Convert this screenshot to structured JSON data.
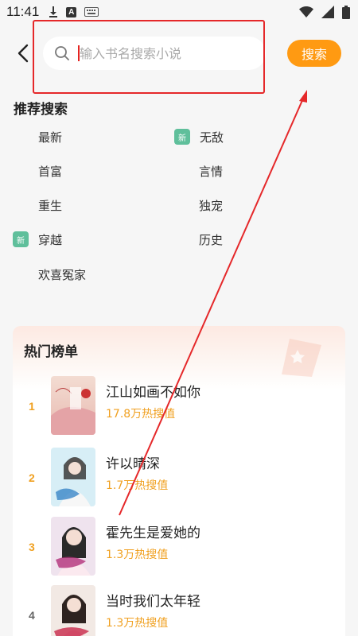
{
  "status": {
    "time": "11:41",
    "icons_left": [
      "download-icon",
      "a-keyboard-icon",
      "keyboard-icon"
    ],
    "icons_right": [
      "wifi-icon",
      "signal-icon",
      "battery-icon"
    ]
  },
  "search": {
    "placeholder": "输入书名搜索小说",
    "button_label": "搜索"
  },
  "recommended": {
    "title": "推荐搜索",
    "new_badge": "新",
    "items": [
      {
        "label": "最新",
        "new": false
      },
      {
        "label": "无敌",
        "new": true
      },
      {
        "label": "首富",
        "new": false
      },
      {
        "label": "言情",
        "new": false
      },
      {
        "label": "重生",
        "new": false
      },
      {
        "label": "独宠",
        "new": false
      },
      {
        "label": "穿越",
        "new": true
      },
      {
        "label": "历史",
        "new": false
      },
      {
        "label": "欢喜冤家",
        "new": false
      }
    ]
  },
  "hot": {
    "title": "热门榜单",
    "books": [
      {
        "rank": "1",
        "title": "江山如画不如你",
        "heat": "17.8万热搜值"
      },
      {
        "rank": "2",
        "title": "许以晴深",
        "heat": "1.7万热搜值"
      },
      {
        "rank": "3",
        "title": "霍先生是爱她的",
        "heat": "1.3万热搜值"
      },
      {
        "rank": "4",
        "title": "当时我们太年轻",
        "heat": "1.3万热搜值"
      }
    ]
  },
  "colors": {
    "accent": "#ff9a12",
    "badge": "#5fbf9b",
    "annotation": "#e5282a"
  }
}
